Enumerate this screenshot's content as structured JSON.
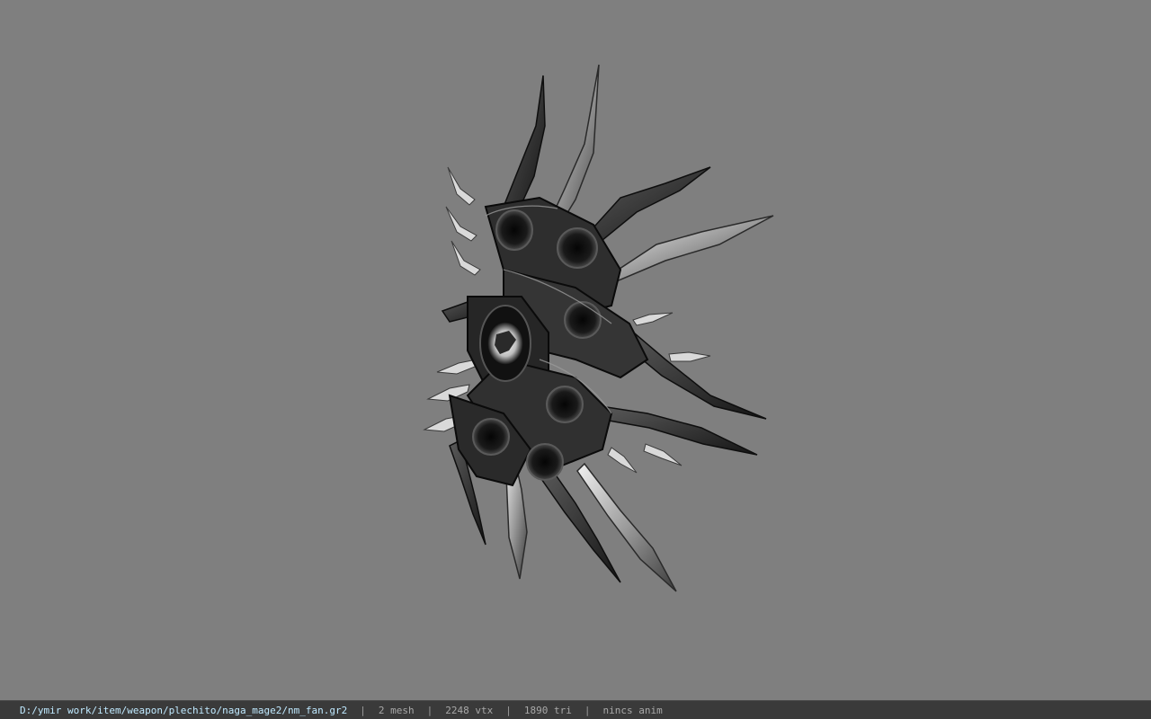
{
  "viewport": {
    "background": "#7f7f7f",
    "model": {
      "name": "weapon-fan-model"
    }
  },
  "status_bar": {
    "file_path": "D:/ymir work/item/weapon/plechito/naga_mage2/nm_fan.gr2",
    "separator": "|",
    "mesh_count": "2 mesh",
    "vertex_count": "2248 vtx",
    "triangle_count": "1890 tri",
    "animation": "nincs anim",
    "path_color": "#bfe9ff"
  }
}
